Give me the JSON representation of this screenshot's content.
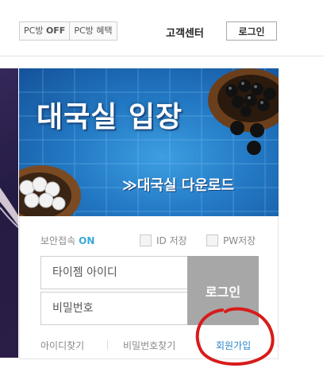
{
  "topbar": {
    "pc_off_prefix": "PC방 ",
    "pc_off_state": "OFF",
    "pc_benefit": "PC방 혜택",
    "customer_center": "고객센터",
    "login": "로그인"
  },
  "promo": {
    "title": "대국실 입장",
    "download": "≫대국실 다운로드"
  },
  "login_box": {
    "secure_label": "보안접속",
    "secure_state": "ON",
    "save_id": "ID 저장",
    "save_pw": "PW저장",
    "id_placeholder": "타이젬 아이디",
    "pw_placeholder": "비밀번호",
    "login_button": "로그인",
    "find_id": "아이디찾기",
    "find_pw": "비밀번호찾기",
    "join": "회원가입"
  },
  "colors": {
    "accent": "#3aa8d8",
    "link": "#2a87c8",
    "login_button": "#a7a7a7",
    "annotation": "#d81b1b"
  }
}
